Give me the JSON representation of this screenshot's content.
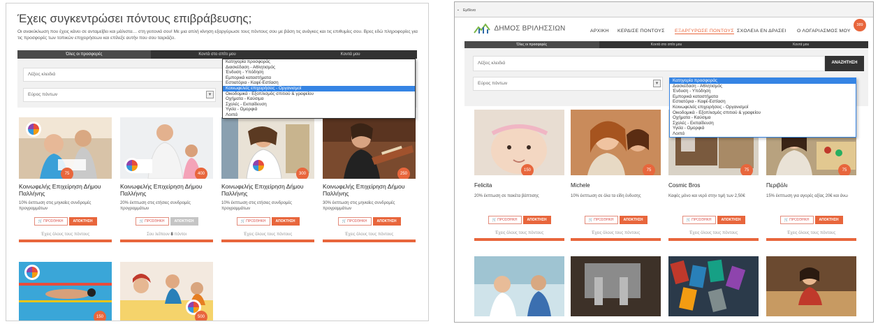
{
  "left": {
    "title": "Έχεις συγκεντρώσει πόντους επιβράβευσης;",
    "subtitle": "Οι ανακύκλωση που έχεις κάνει σε ανταμείβει και μάλιστα… στη γειτονιά σου! Με μια απλή κίνηση εξαργύρωσε τους πόντους σου με βάση τις ανάγκες και τις επιθυμίες σου. Βρες εδώ πληροφορίες για τις προσφορές των τοπικών επιχειρήσεων και επίλεξε αυτήν που σου ταιριάζει.",
    "tabs": [
      "Όλες οι προσφορές",
      "Κοντά στο σπίτι μου",
      "Κοντά μου"
    ],
    "keywords_placeholder": "Λέξεις κλειδιά",
    "points_range": "Εύρος πόντων",
    "category_options": [
      "Κατηγορία προσφοράς",
      "Διασκέδαση - Αθλητισμός",
      "Ένδυση - Υπόδηση",
      "Εμπορικά καταστήματα",
      "Εστιατόρια - Καφέ-Εστίαση",
      "Κοινωφελείς επιχειρήσεις - Οργανισμοί",
      "Οικοδομικά - Εξοπλισμός σπιτιού & γραφείου",
      "Οχήματα - Καύσιμα",
      "Σχολές - Εκπαίδευση",
      "Υγεία - Ομορφιά",
      "Λοιπά"
    ],
    "selected_option_index": 5,
    "cards": [
      {
        "points": "75",
        "name": "Κοινωφελής Επιχείρηση Δήμου Παλλήνης",
        "desc": "10% έκπτωση στις μηνιαίες συνδρομές προγραμμάτων",
        "cart": "ΠΡΟΣΘΗΚΗ",
        "buy": "ΑΠΟΚΤΗΣΗ",
        "footer": "Έχεις όλους τους πόντους"
      },
      {
        "points": "400",
        "name": "Κοινωφελής Επιχείρηση Δήμου Παλλήνης",
        "desc": "20% έκπτωση στις ετήσιες συνδρομές προγραμμάτων",
        "cart": "ΠΡΟΣΘΗΚΗ",
        "buy": "ΑΠΟΚΤΗΣΗ",
        "footer_pre": "Σου λείπουν",
        "footer_num": "8",
        "footer_post": "πόντοι"
      },
      {
        "points": "300",
        "name": "Κοινωφελής Επιχείρηση Δήμου Παλλήνης",
        "desc": "10% έκπτωση στις ετήσιες συνδρομές προγραμμάτων",
        "cart": "ΠΡΟΣΘΗΚΗ",
        "buy": "ΑΠΟΚΤΗΣΗ",
        "footer": "Έχεις όλους τους πόντους"
      },
      {
        "points": "250",
        "name": "Κοινωφελής Επιχείρηση Δήμου Παλλήνης",
        "desc": "30% έκπτωση στις μηνιαίες συνδρομές προγραμμάτων",
        "cart": "ΠΡΟΣΘΗΚΗ",
        "buy": "ΑΠΟΚΤΗΣΗ",
        "footer": "Έχεις όλους τους πόντους"
      }
    ],
    "bottom_points": [
      "150",
      "500"
    ]
  },
  "right": {
    "window_title": "",
    "menu": "Εμθλινα",
    "brand": "ΔΗΜΟΣ ΒΡΙΛΗΣΣΙΩΝ",
    "nav": [
      "ΑΡΧΙΚΗ",
      "ΚΕΡΔΙΣΕ ΠΟΝΤΟΥΣ",
      "ΕΞΑΡΓΥΡΩΣΕ ΠΟΝΤΟΥΣ",
      "ΣΧΟΛΕΙΑ ΕΝ ΔΡΑΣΕΙ",
      "Ο ΛΟΓΑΡΙΑΣΜΟΣ ΜΟΥ"
    ],
    "account_points": "389",
    "tabs": [
      "Όλες οι προσφορές",
      "Κοντά στο σπίτι μου",
      "Κοντά μου"
    ],
    "keywords_placeholder": "Λέξεις κλειδιά",
    "search_button": "ΑΝΑΖΗΤΗΣΗ",
    "points_range": "Εύρος πόντων",
    "category_options": [
      "Κατηγορία προσφοράς",
      "Διασκέδαση - Αθλητισμός",
      "Ένδυση - Υπόδηση",
      "Εμπορικά καταστήματα",
      "Εστιατόρια - Καφέ-Εστίαση",
      "Κοινωφελείς επιχειρήσεις - Οργανισμοί",
      "Οικοδομικά - Εξοπλισμός σπιτιού & γραφείου",
      "Οχήματα - Καύσιμα",
      "Σχολές - Εκπαίδευση",
      "Υγεία - Ομορφιά",
      "Λοιπά"
    ],
    "selected_option_index": 0,
    "cards": [
      {
        "points": "150",
        "name": "Felicita",
        "desc": "20% έκπτωση σε πακέτα βάπτισης",
        "cart": "ΠΡΟΣΘΗΚΗ",
        "buy": "ΑΠΟΚΤΗΣΗ",
        "footer": "Έχεις όλους τους πόντους"
      },
      {
        "points": "75",
        "name": "Michele",
        "desc": "10% έκπτωση σε όλα τα είδη ένδυσης",
        "cart": "ΠΡΟΣΘΗΚΗ",
        "buy": "ΑΠΟΚΤΗΣΗ",
        "footer": "Έχεις όλους τους πόντους"
      },
      {
        "points": "75",
        "name": "Cosmic Bros",
        "desc": "Καφές μόνο και νερό στην τιμή των 2,50€",
        "cart": "ΠΡΟΣΘΗΚΗ",
        "buy": "ΑΠΟΚΤΗΣΗ",
        "footer": "Έχεις όλους τους πόντους"
      },
      {
        "points": "75",
        "name": "Περιβόλι",
        "desc": "15% έκπτωση για αγορές αξίας 20€ και άνω",
        "cart": "ΠΡΟΣΘΗΚΗ",
        "buy": "ΑΠΟΚΤΗΣΗ",
        "footer": "Έχεις όλους τους πόντους"
      }
    ]
  },
  "colors": {
    "accent": "#e8663c",
    "dark_bar": "#333333",
    "selection": "#3584e4"
  }
}
